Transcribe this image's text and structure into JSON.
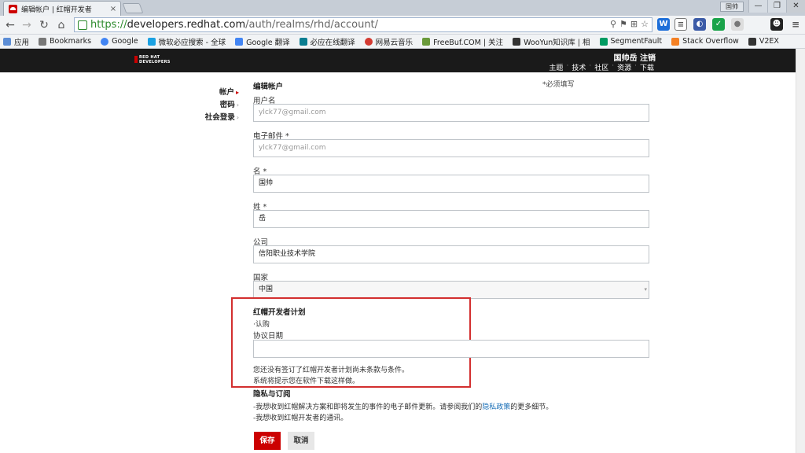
{
  "browser": {
    "tab_title": "编辑帐户 | 红帽开发者",
    "tab_close": "×",
    "window_user": "国帅",
    "url_scheme": "https://",
    "url_host": "developers.redhat.com",
    "url_path": "/auth/realms/rhd/account/",
    "window_buttons": [
      "—",
      "❐",
      "✕"
    ],
    "bookmarks": [
      {
        "label": "应用",
        "color": "#5b8dd6"
      },
      {
        "label": "Bookmarks",
        "color": "#777777"
      },
      {
        "label": "Google",
        "color": "#4285f4"
      },
      {
        "label": "微软必应搜索 - 全球",
        "color": "#1ba1e2"
      },
      {
        "label": "Google 翻译",
        "color": "#4285f4"
      },
      {
        "label": "必应在线翻译",
        "color": "#0a7d91"
      },
      {
        "label": "网易云音乐",
        "color": "#d33a31"
      },
      {
        "label": "FreeBuf.COM | 关注",
        "color": "#6a9a3a"
      },
      {
        "label": "WooYun知识库 | 相",
        "color": "#333333"
      },
      {
        "label": "SegmentFault",
        "color": "#009a61"
      },
      {
        "label": "Stack Overflow",
        "color": "#f48024"
      },
      {
        "label": "V2EX",
        "color": "#333333"
      }
    ]
  },
  "header": {
    "logo_line1": "RED HAT",
    "logo_line2": "DEVELOPERS",
    "user_links": "国帅岳 注销",
    "nav": [
      "主题",
      "技术",
      "社区",
      "资源",
      "下载"
    ]
  },
  "sidebar": {
    "items": [
      {
        "label": "帐户",
        "active": true
      },
      {
        "label": "密码",
        "active": false
      },
      {
        "label": "社会登录",
        "active": false
      }
    ]
  },
  "form": {
    "title": "编辑帐户",
    "required_note": "*必须填写",
    "username_label": "用户名",
    "username_value": "ylck77@gmail.com",
    "email_label": "电子邮件 *",
    "email_value": "ylck77@gmail.com",
    "firstname_label": "名 *",
    "firstname_value": "国帅",
    "lastname_label": "姓 *",
    "lastname_value": "岳",
    "company_label": "公司",
    "company_value": "信阳职业技术学院",
    "country_label": "国家",
    "country_value": "中国",
    "program_title": "红帽开发者计划",
    "program_subscribe": "·认购",
    "agreement_date_label": "协议日期",
    "agreement_date_value": "",
    "agreement_note_1": "您还没有签订了红帽开发者计划尚未条款与条件。",
    "agreement_note_2": "系统将提示您在软件下载这样做。",
    "privacy_title": "隐私与订阅",
    "privacy_line1_prefix": "-我想收到红帽解决方案和即将发生的事件的电子邮件更新。请参阅我们的",
    "privacy_line1_link": "隐私政策",
    "privacy_line1_suffix": "的更多细节。",
    "privacy_line2": "-我想收到红帽开发者的通讯。",
    "save_label": "保存",
    "cancel_label": "取消"
  },
  "colors": {
    "accent": "#cc0000",
    "highlight_box": "#d32f2f",
    "link": "#1a6fb7"
  }
}
